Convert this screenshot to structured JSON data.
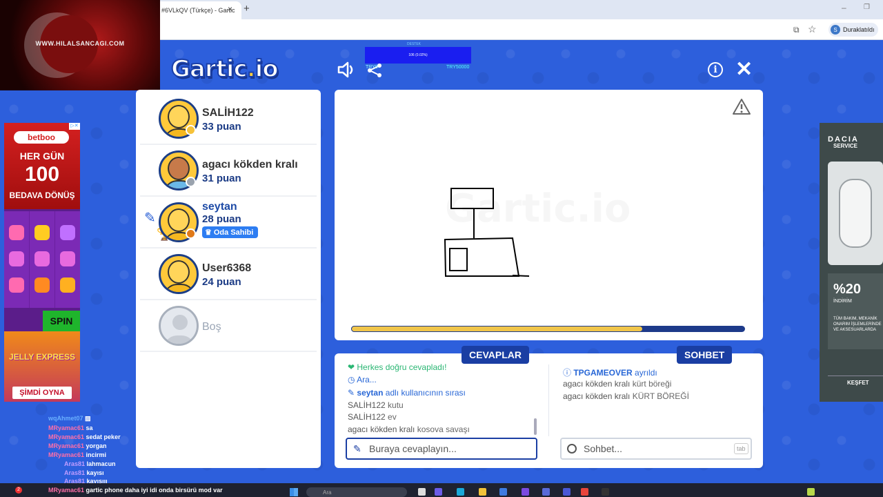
{
  "browser": {
    "tab_title": "#6VLkQV (Türkçe) - Gartic",
    "tab_close": "×",
    "new_tab": "+",
    "minimize": "–",
    "maximize": "❐",
    "profile_initial": "S",
    "profile_status": "Duraklatıldı"
  },
  "stream_overlay": {
    "site_text": "WWW.HILALSANCAGI.COM",
    "donation_label": "DESTEK",
    "donation_progress": "106 (0.02%)",
    "donation_progress_fraction": 0.0002,
    "donation_left": "TRY0",
    "donation_right": "TRY50000"
  },
  "header": {
    "logo_main": "Gartic",
    "logo_dot": ".",
    "logo_suffix": "io",
    "sound_icon": "speaker-icon",
    "share_icon": "share-icon",
    "info_label": "i",
    "close_label": "✕"
  },
  "players": [
    {
      "name": "SALİH122",
      "score": "33 puan",
      "status_color": "#f6c23a"
    },
    {
      "name": "agacı kökden kralı",
      "score": "31 puan",
      "status_color": "#9aa3ae"
    },
    {
      "name": "seytan",
      "score": "28 puan",
      "status_color": "#e07a1a",
      "badge": "Oda Sahibi"
    },
    {
      "name": "User6368",
      "score": "24 puan"
    },
    {
      "name": "Boş"
    }
  ],
  "canvas": {
    "watermark": "Gartic.io",
    "timer_fraction": 0.74,
    "report_icon": "warning-icon"
  },
  "answers": {
    "tab_label": "CEVAPLAR",
    "messages": {
      "everyone": "Herkes doğru cevapladı!",
      "searching": "Ara...",
      "turn_user": "seytan",
      "turn_text": "adlı kullanıcının sırası",
      "m1_user": "SALİH122",
      "m1_text": "kutu",
      "m2_user": "SALİH122",
      "m2_text": "ev",
      "m3_user": "agacı kökden kralı",
      "m3_text": "kosova savaşı"
    },
    "input_placeholder": "Buraya cevaplayın..."
  },
  "chat": {
    "tab_label": "SOHBET",
    "messages": {
      "s1_user": "TPGAMEOVER",
      "s1_text": "ayrıldı",
      "s2_user": "agacı kökden kralı",
      "s2_text": "kürt böreği",
      "s3_user": "agacı kökden kralı",
      "s3_text": "KÜRT BÖREĞİ"
    },
    "input_placeholder": "Sohbet...",
    "tab_key": "tab"
  },
  "ad_left": {
    "brand": "betboo",
    "line1": "HER GÜN",
    "line2": "100",
    "line3": "BEDAVA DÖNÜŞ",
    "spin": "SPIN",
    "game": "JELLY EXPRESS",
    "cta": "ŞİMDİ OYNA"
  },
  "ad_right": {
    "brand": "DACIA",
    "service": "SERVICE",
    "percent": "%20",
    "percent_sub": "İNDİRİM",
    "offer_text": "TÜM BAKIM, MEKANİK ONARIM İŞLEMLERİNDE VE AKSESUARLARDA",
    "discover": "KEŞFET"
  },
  "stream_chat": [
    {
      "user": "wqAhmet07",
      "text": ""
    },
    {
      "user": "MRyamac61",
      "text": "sa"
    },
    {
      "user": "MRyamac61",
      "text": "sedat peker"
    },
    {
      "user": "MRyamac61",
      "text": "yorgan"
    },
    {
      "user": "MRyamac61",
      "text": "incirmi"
    },
    {
      "user": "Aras81",
      "text": "lahmacun"
    },
    {
      "user": "Aras81",
      "text": "kayısı"
    },
    {
      "user": "Aras81",
      "text": "kayısııı"
    },
    {
      "user": "MRyamac61",
      "text": "gartic phone daha iyi idi onda birsürü mod var"
    }
  ],
  "taskbar": {
    "search_placeholder": "Ara",
    "notification_count": "2"
  }
}
